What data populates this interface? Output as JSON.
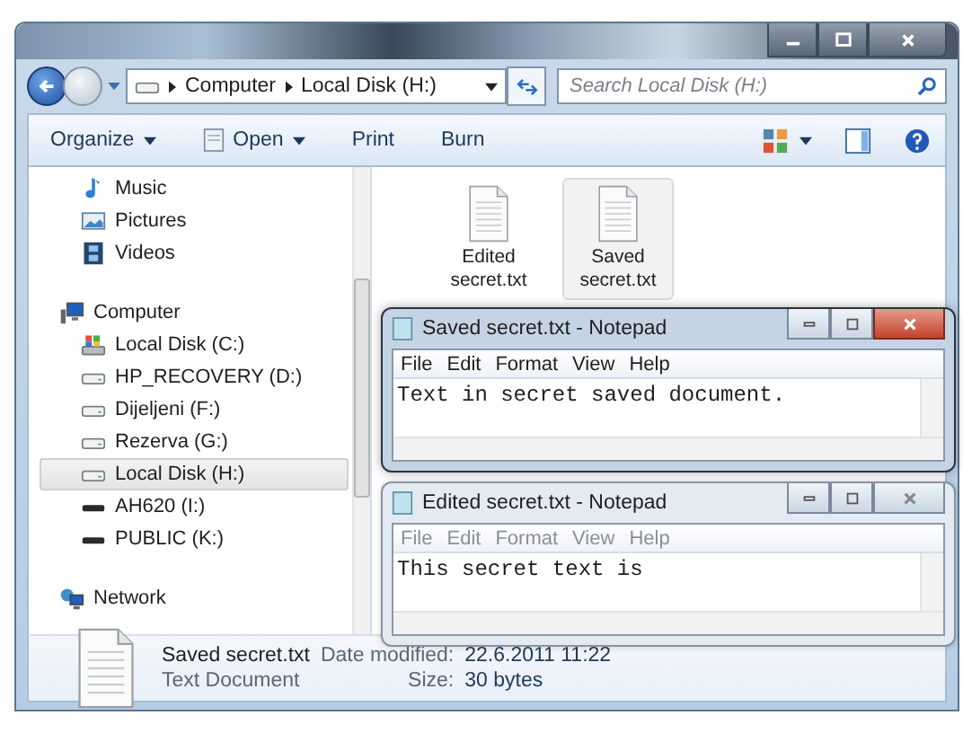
{
  "address": {
    "crumbs": [
      "Computer",
      "Local Disk (H:)"
    ],
    "search": {
      "placeholder": "Search Local Disk (H:)"
    }
  },
  "toolbar": [
    {
      "label": "Organize",
      "kind": "menu"
    },
    {
      "label": "Open",
      "kind": "open"
    },
    {
      "label": "Print",
      "kind": "plain"
    },
    {
      "label": "Burn",
      "kind": "plain"
    }
  ],
  "nav": {
    "libraries": [
      {
        "label": "Music",
        "kind": "music",
        "selected": false
      },
      {
        "label": "Pictures",
        "kind": "pictures",
        "selected": false
      },
      {
        "label": "Videos",
        "kind": "videos",
        "selected": false
      }
    ],
    "computer": {
      "label": "Computer",
      "kind": "computer",
      "selected": false,
      "children": [
        {
          "label": "Local Disk (C:)",
          "kind": "system-drive",
          "selected": false
        },
        {
          "label": "HP_RECOVERY (D:)",
          "kind": "drive",
          "selected": false
        },
        {
          "label": "Dijeljeni (F:)",
          "kind": "drive",
          "selected": false
        },
        {
          "label": "Rezerva (G:)",
          "kind": "drive",
          "selected": false
        },
        {
          "label": "Local Disk (H:)",
          "kind": "drive",
          "selected": true
        },
        {
          "label": "AH620 (I:)",
          "kind": "removable",
          "selected": false
        },
        {
          "label": "PUBLIC (K:)",
          "kind": "removable",
          "selected": false
        }
      ]
    },
    "network": {
      "label": "Network",
      "kind": "network",
      "selected": false
    }
  },
  "files": [
    {
      "name": "Edited secret.txt",
      "selected": false
    },
    {
      "name": "Saved secret.txt",
      "selected": true
    }
  ],
  "notepads": [
    {
      "title": "Saved secret.txt - Notepad",
      "active": true,
      "menu": [
        "File",
        "Edit",
        "Format",
        "View",
        "Help"
      ],
      "text": "Text in secret saved document."
    },
    {
      "title": "Edited secret.txt - Notepad",
      "active": false,
      "menu": [
        "File",
        "Edit",
        "Format",
        "View",
        "Help"
      ],
      "text": "This secret text is"
    }
  ],
  "details": {
    "name": "Saved secret.txt",
    "type": "Text Document",
    "date_label": "Date modified:",
    "date": "22.6.2011 11:22",
    "size_label": "Size:",
    "size": "30 bytes"
  }
}
